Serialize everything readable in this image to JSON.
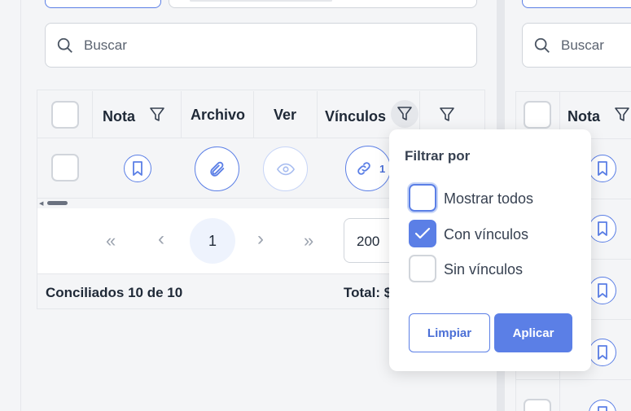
{
  "left": {
    "search_placeholder": "Buscar",
    "columns": {
      "nota": "Nota",
      "archivo": "Archivo",
      "ver": "Ver",
      "vinculos": "Vínculos"
    },
    "row": {
      "vinculos_count": "1"
    },
    "pagination": {
      "first": "«",
      "prev": "‹",
      "current": "1",
      "next": "›",
      "last": "»",
      "page_size": "200"
    },
    "footer": {
      "conciliados": "Conciliados 10 de 10",
      "total": "Total: $"
    }
  },
  "right": {
    "search_placeholder": "Buscar",
    "columns": {
      "nota": "Nota"
    }
  },
  "filter_popover": {
    "title": "Filtrar por",
    "options": [
      {
        "label": "Mostrar todos",
        "checked": false
      },
      {
        "label": "Con vínculos",
        "checked": true
      },
      {
        "label": "Sin vínculos",
        "checked": false
      }
    ],
    "clear_label": "Limpiar",
    "apply_label": "Aplicar"
  },
  "colors": {
    "accent": "#5b7fe6",
    "border": "#d1d5db",
    "text": "#1f2937"
  }
}
